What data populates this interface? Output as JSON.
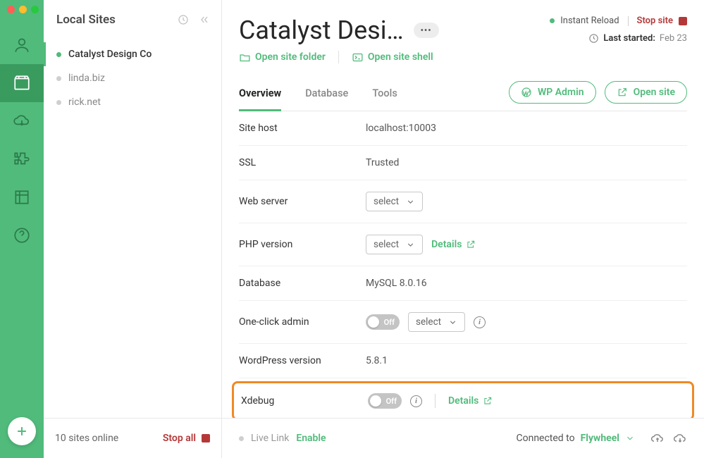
{
  "sidebar": {
    "title": "Local Sites",
    "items": [
      {
        "label": "Catalyst Design Co",
        "active": true
      },
      {
        "label": "linda.biz",
        "active": false
      },
      {
        "label": "rick.net",
        "active": false
      }
    ],
    "footer_status": "10 sites online",
    "stop_all": "Stop all"
  },
  "header": {
    "site_title": "Catalyst Desi…",
    "instant_reload": "Instant Reload",
    "stop_site": "Stop site",
    "last_started_label": "Last started:",
    "last_started_value": "Feb 23",
    "open_folder": "Open site folder",
    "open_shell": "Open site shell",
    "wp_admin": "WP Admin",
    "open_site": "Open site"
  },
  "tabs": [
    "Overview",
    "Database",
    "Tools"
  ],
  "rows": {
    "site_host": {
      "label": "Site host",
      "value": "localhost:10003"
    },
    "ssl": {
      "label": "SSL",
      "value": "Trusted"
    },
    "web_server": {
      "label": "Web server",
      "select": "select"
    },
    "php": {
      "label": "PHP version",
      "select": "select",
      "details": "Details"
    },
    "database": {
      "label": "Database",
      "value": "MySQL 8.0.16"
    },
    "one_click": {
      "label": "One-click admin",
      "toggle": "Off",
      "select": "select"
    },
    "wp_version": {
      "label": "WordPress version",
      "value": "5.8.1"
    },
    "xdebug": {
      "label": "Xdebug",
      "toggle": "Off",
      "details": "Details"
    }
  },
  "footer": {
    "live_link": "Live Link",
    "enable": "Enable",
    "connected_to": "Connected to",
    "host": "Flywheel"
  }
}
